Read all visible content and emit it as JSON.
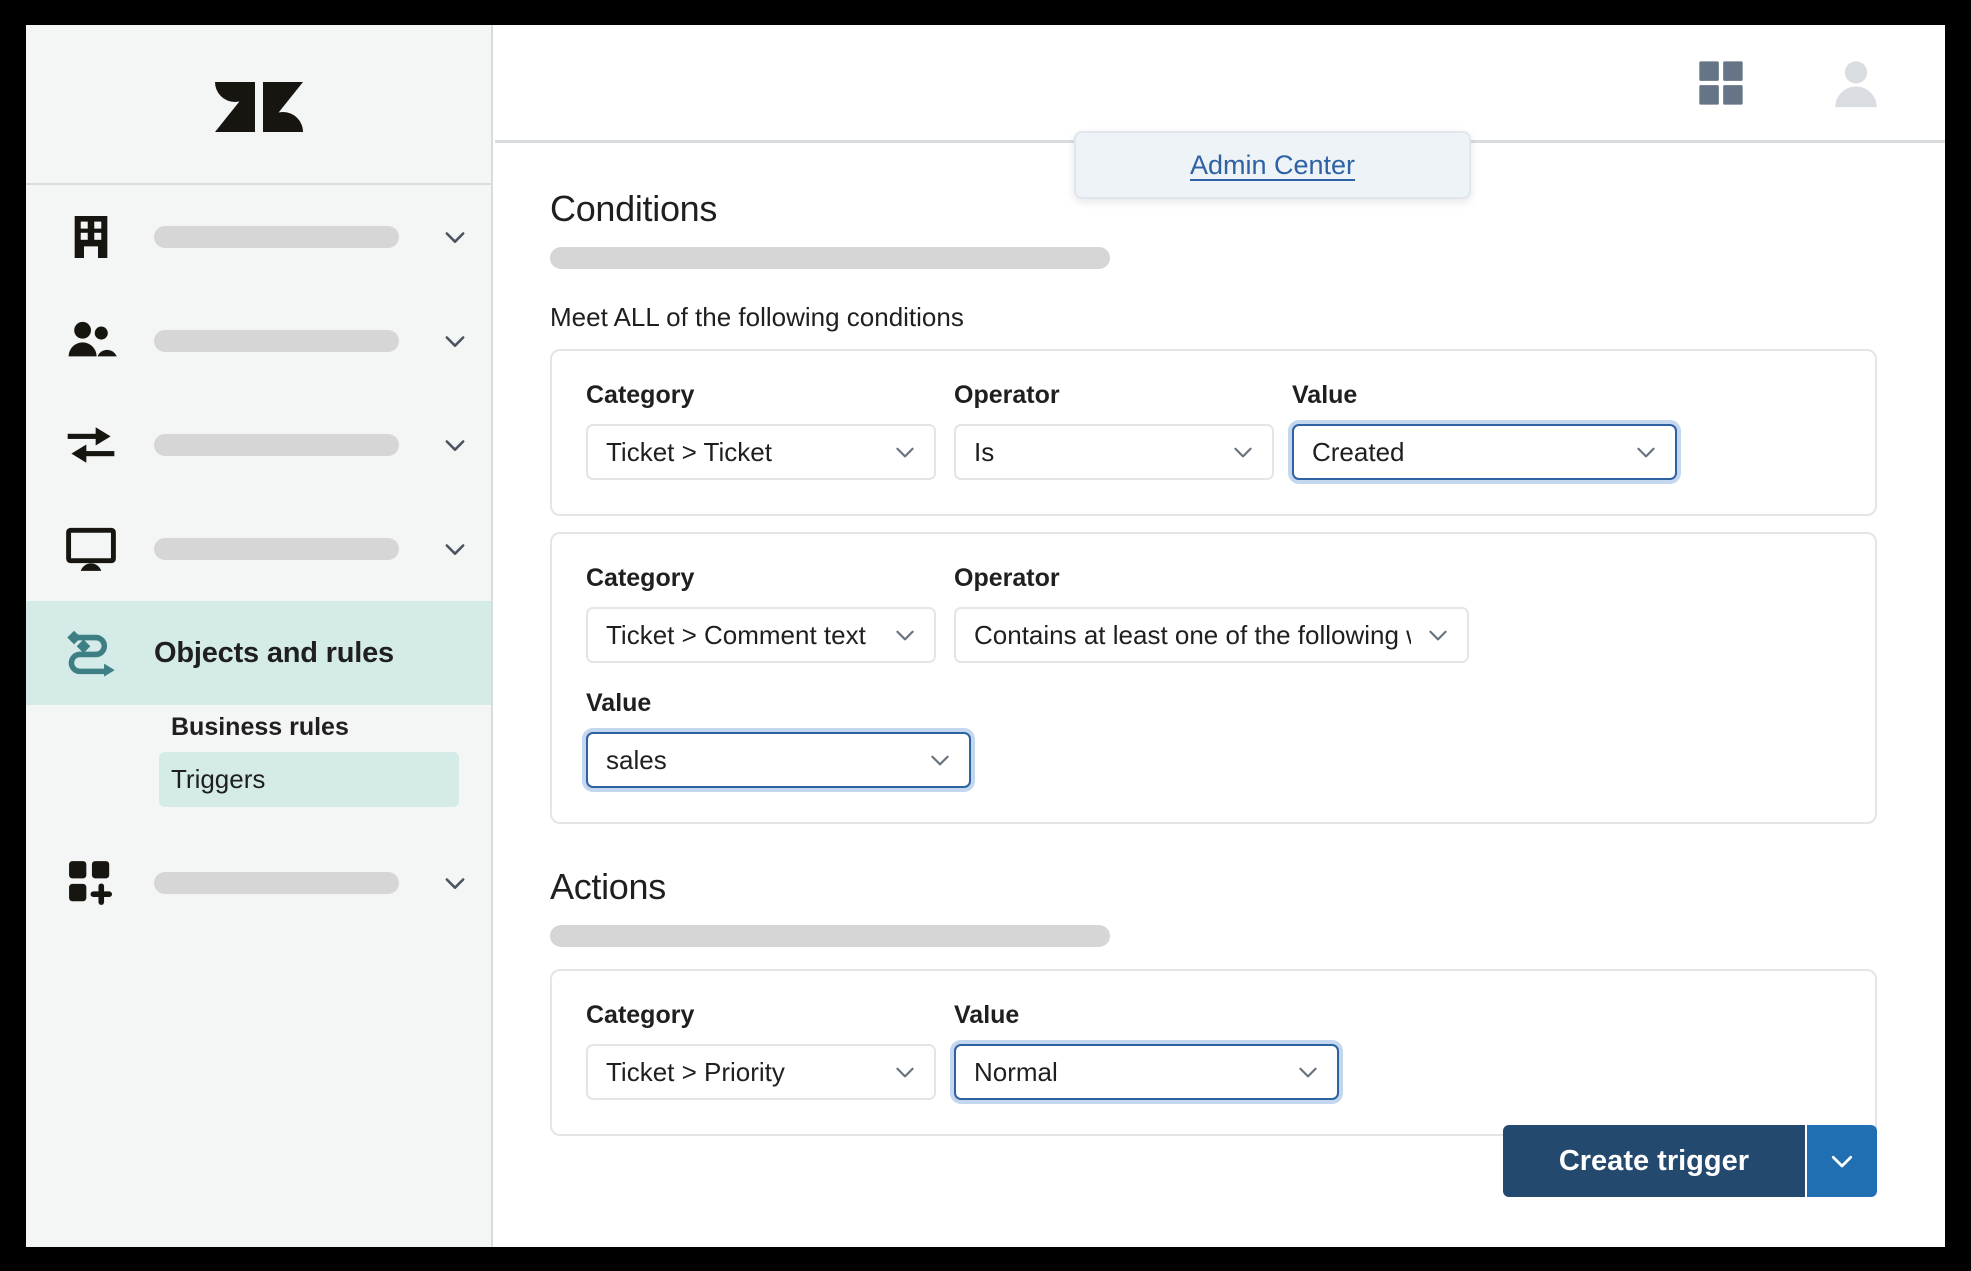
{
  "header": {
    "grid_icon": "grid-apps-icon",
    "avatar_icon": "user-avatar-icon",
    "admin_center_link": "Admin Center"
  },
  "sidebar": {
    "logo": "zendesk-logo",
    "items": [
      {
        "icon": "building-icon",
        "label": ""
      },
      {
        "icon": "people-icon",
        "label": ""
      },
      {
        "icon": "transfer-arrows-icon",
        "label": ""
      },
      {
        "icon": "workspace-monitor-icon",
        "label": ""
      }
    ],
    "active_item": {
      "icon": "objects-rules-icon",
      "label": "Objects and rules"
    },
    "sub_heading": "Business rules",
    "sub_items": [
      {
        "label": "Triggers",
        "selected": true
      }
    ],
    "bottom_item": {
      "icon": "apps-add-icon",
      "label": ""
    }
  },
  "conditions": {
    "title": "Conditions",
    "meet_text": "Meet ALL of the following conditions",
    "rows": [
      {
        "category_label": "Category",
        "category_value": "Ticket > Ticket",
        "operator_label": "Operator",
        "operator_value": "Is",
        "value_label": "Value",
        "value_value": "Created"
      },
      {
        "category_label": "Category",
        "category_value": "Ticket > Comment text",
        "operator_label": "Operator",
        "operator_value": "Contains at least one of the following words",
        "value_label": "Value",
        "value_value": "sales"
      }
    ]
  },
  "actions": {
    "title": "Actions",
    "row": {
      "category_label": "Category",
      "category_value": "Ticket > Priority",
      "value_label": "Value",
      "value_value": "Normal"
    }
  },
  "footer": {
    "create_label": "Create trigger",
    "caret_icon": "chevron-down-icon"
  },
  "colors": {
    "accent_teal": "#d4ebe7",
    "link_blue": "#2e62a3",
    "primary_navy": "#23496e",
    "caret_blue": "#1f6fb2",
    "focus_ring": "#c3d7ef"
  }
}
